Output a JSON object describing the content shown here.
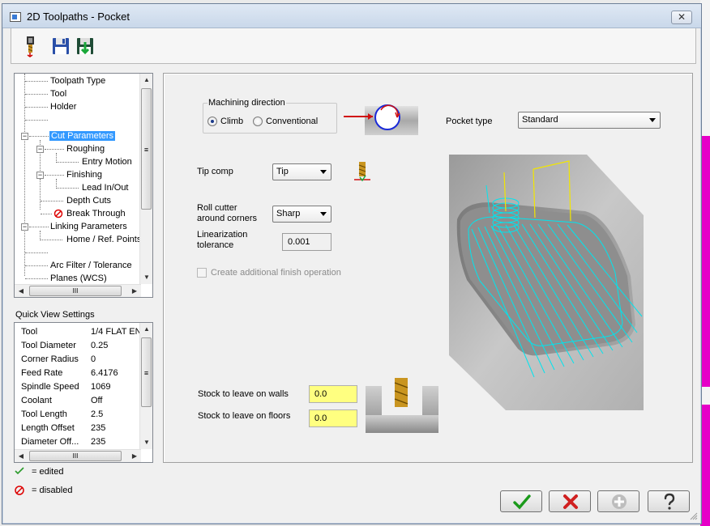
{
  "window": {
    "title": "2D Toolpaths - Pocket",
    "close_glyph": "✕"
  },
  "toolbar": {
    "buttons": [
      {
        "icon": "tool-icon"
      },
      {
        "icon": "save-icon"
      },
      {
        "icon": "save-to-library-icon"
      }
    ]
  },
  "tree": {
    "items": [
      {
        "label": "Toolpath Type"
      },
      {
        "label": "Tool"
      },
      {
        "label": "Holder"
      },
      {
        "label": ""
      },
      {
        "label": "Cut Parameters"
      },
      {
        "label": "Roughing"
      },
      {
        "label": "Entry Motion"
      },
      {
        "label": "Finishing"
      },
      {
        "label": "Lead In/Out"
      },
      {
        "label": "Depth Cuts"
      },
      {
        "label": "Break Through"
      },
      {
        "label": "Linking Parameters"
      },
      {
        "label": "Home / Ref. Points"
      },
      {
        "label": ""
      },
      {
        "label": "Arc Filter / Tolerance"
      },
      {
        "label": "Planes (WCS)"
      }
    ],
    "expander_collapse": "−",
    "scroll_grip": "≡",
    "hscroll_grip": "III"
  },
  "quick_view": {
    "title": "Quick View Settings",
    "rows": [
      {
        "key": "Tool",
        "value": "1/4 FLAT EN..."
      },
      {
        "key": "Tool Diameter",
        "value": "0.25"
      },
      {
        "key": "Corner Radius",
        "value": "0"
      },
      {
        "key": "Feed Rate",
        "value": "6.4176"
      },
      {
        "key": "Spindle Speed",
        "value": "1069"
      },
      {
        "key": "Coolant",
        "value": "Off"
      },
      {
        "key": "Tool Length",
        "value": "2.5"
      },
      {
        "key": "Length Offset",
        "value": "235"
      },
      {
        "key": "Diameter Off...",
        "value": "235"
      }
    ]
  },
  "legend": {
    "edited": "= edited",
    "disabled": "= disabled"
  },
  "cut_params": {
    "machining_direction": {
      "label": "Machining direction",
      "options": [
        "Climb",
        "Conventional"
      ],
      "selected": "Climb"
    },
    "pocket_type": {
      "label": "Pocket type",
      "value": "Standard"
    },
    "tip_comp": {
      "label": "Tip comp",
      "value": "Tip"
    },
    "roll_cutter": {
      "label_line1": "Roll cutter",
      "label_line2": "around corners",
      "value": "Sharp"
    },
    "linearization": {
      "label_line1": "Linearization",
      "label_line2": "tolerance",
      "value": "0.001"
    },
    "additional_finish": {
      "label": "Create additional finish operation",
      "checked": false
    },
    "stock_walls": {
      "label": "Stock to leave on walls",
      "value": "0.0"
    },
    "stock_floors": {
      "label": "Stock to leave on floors",
      "value": "0.0"
    }
  },
  "colors": {
    "selection": "#3399ff",
    "toolpath": "#00e5ee",
    "stock_input": "#ffff80",
    "ok_green": "#1a9a1a",
    "cancel_red": "#d02020"
  },
  "buttons": {
    "ok": {
      "icon": "checkmark-icon"
    },
    "cancel": {
      "icon": "x-icon"
    },
    "add": {
      "icon": "plus-icon"
    },
    "help": {
      "icon": "question-icon"
    }
  }
}
